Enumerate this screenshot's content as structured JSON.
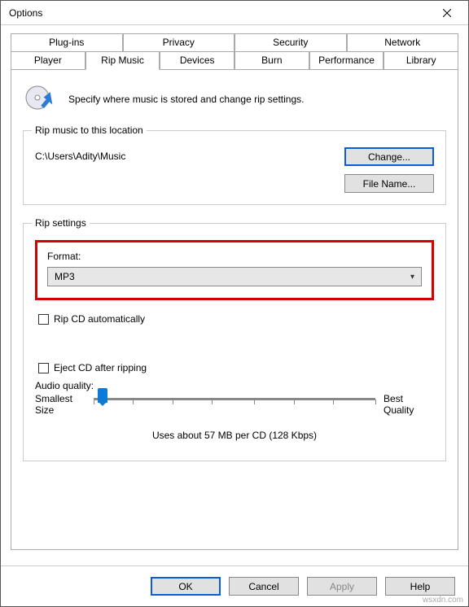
{
  "window": {
    "title": "Options"
  },
  "tabs": {
    "row1": [
      "Plug-ins",
      "Privacy",
      "Security",
      "Network"
    ],
    "row2": [
      "Player",
      "Rip Music",
      "Devices",
      "Burn",
      "Performance",
      "Library"
    ],
    "active": "Rip Music"
  },
  "panel": {
    "description": "Specify where music is stored and change rip settings."
  },
  "rip_location": {
    "legend": "Rip music to this location",
    "path": "C:\\Users\\Adity\\Music",
    "change_btn": "Change...",
    "filename_btn": "File Name..."
  },
  "rip_settings": {
    "legend": "Rip settings",
    "format_label": "Format:",
    "format_value": "MP3",
    "rip_auto_label": "Rip CD automatically",
    "eject_label": "Eject CD after ripping",
    "aq_label": "Audio quality:",
    "aq_left": "Smallest\nSize",
    "aq_right": "Best\nQuality",
    "aq_caption": "Uses about 57 MB per CD (128 Kbps)"
  },
  "footer": {
    "ok": "OK",
    "cancel": "Cancel",
    "apply": "Apply",
    "help": "Help"
  },
  "watermark": "wsxdn.com"
}
